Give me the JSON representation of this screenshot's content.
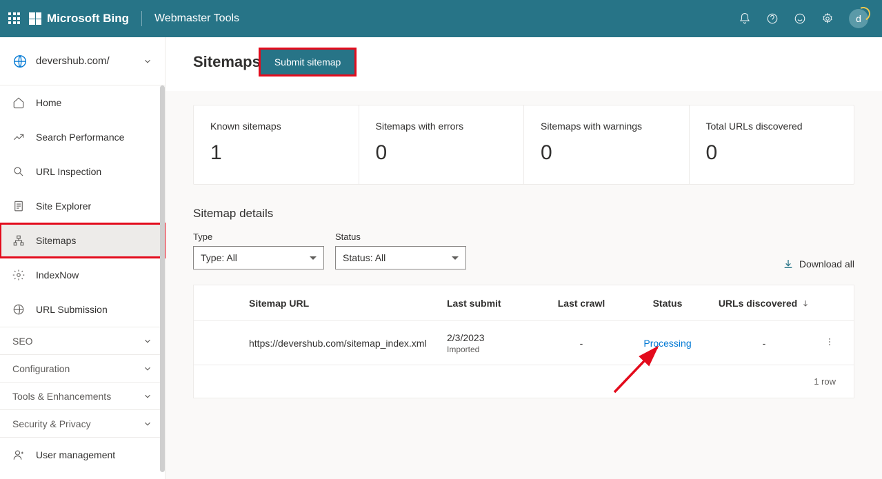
{
  "header": {
    "brand": "Microsoft Bing",
    "subtitle": "Webmaster Tools",
    "avatar_letter": "d"
  },
  "sidebar": {
    "site": "devershub.com/",
    "items": [
      {
        "label": "Home"
      },
      {
        "label": "Search Performance"
      },
      {
        "label": "URL Inspection"
      },
      {
        "label": "Site Explorer"
      },
      {
        "label": "Sitemaps"
      },
      {
        "label": "IndexNow"
      },
      {
        "label": "URL Submission"
      }
    ],
    "sections": [
      {
        "label": "SEO"
      },
      {
        "label": "Configuration"
      },
      {
        "label": "Tools & Enhancements"
      },
      {
        "label": "Security & Privacy"
      }
    ],
    "user_mgmt": "User management"
  },
  "page": {
    "title": "Sitemaps",
    "submit_label": "Submit sitemap",
    "cards": [
      {
        "label": "Known sitemaps",
        "value": "1"
      },
      {
        "label": "Sitemaps with errors",
        "value": "0"
      },
      {
        "label": "Sitemaps with warnings",
        "value": "0"
      },
      {
        "label": "Total URLs discovered",
        "value": "0"
      }
    ],
    "details_title": "Sitemap details",
    "type_label": "Type",
    "type_value": "Type: All",
    "status_label": "Status",
    "status_value": "Status: All",
    "download_label": "Download all",
    "columns": {
      "url": "Sitemap URL",
      "submit": "Last submit",
      "crawl": "Last crawl",
      "status": "Status",
      "urls": "URLs discovered"
    },
    "rows": [
      {
        "url": "https://devershub.com/sitemap_index.xml",
        "submit_date": "2/3/2023",
        "submit_note": "Imported",
        "crawl": "-",
        "status": "Processing",
        "urls": "-"
      }
    ],
    "footer": "1 row"
  }
}
